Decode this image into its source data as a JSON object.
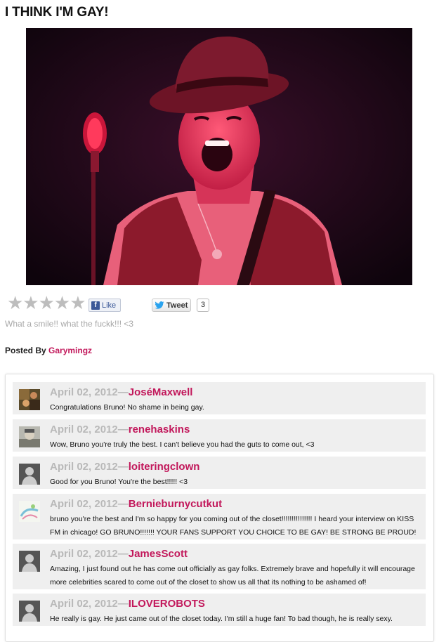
{
  "post": {
    "title": "I THINK I'M GAY!",
    "caption": "What a smile!! what the fuckk!!! <3",
    "posted_by_label": "Posted By",
    "author": "Garymingz"
  },
  "rating": {
    "stars_text": "★★★★★",
    "filled": 0,
    "max": 5
  },
  "social": {
    "like_label": "Like",
    "tweet_label": "Tweet",
    "tweet_count": "3"
  },
  "colors": {
    "accent": "#c2185b",
    "date_gray": "#b9b9b9",
    "comment_bg": "#efefef"
  },
  "comments": [
    {
      "date": "April 02, 2012",
      "dash": "—",
      "user": "JoséMaxwell",
      "avatar": "photo-collage-avatar",
      "text": "Congratulations Bruno! No shame in being gay."
    },
    {
      "date": "April 02, 2012",
      "dash": "—",
      "user": "renehaskins",
      "avatar": "photo-avatar",
      "text": "Wow, Bruno you're truly the best. I can't believe you had the guts to come out, <3"
    },
    {
      "date": "April 02, 2012",
      "dash": "—",
      "user": "loiteringclown",
      "avatar": "default-user-icon",
      "text": "Good for you Bruno! You're the best!!!!! <3"
    },
    {
      "date": "April 02, 2012",
      "dash": "—",
      "user": "Bernieburnycutkut",
      "avatar": "drawing-avatar",
      "text": "bruno you're the best and I'm so happy for you coming out of the closet!!!!!!!!!!!!!!! I heard your interview on KISS FM in chicago! GO BRUNO!!!!!!! YOUR FANS SUPPORT YOU CHOICE TO BE GAY! BE STRONG BE PROUD!"
    },
    {
      "date": "April 02, 2012",
      "dash": "—",
      "user": "JamesScott",
      "avatar": "default-user-icon",
      "text": "Amazing, I just found out he has come out officially as gay folks. Extremely brave and hopefully it will encourage more celebrities scared to come out of the closet to show us all that its nothing to be ashamed of!"
    },
    {
      "date": "April 02, 2012",
      "dash": "—",
      "user": "ILOVEROBOTS",
      "avatar": "default-user-icon",
      "text": "He really is gay. He just came out of the closet today. I'm still a huge fan! To bad though, he is really sexy."
    }
  ]
}
